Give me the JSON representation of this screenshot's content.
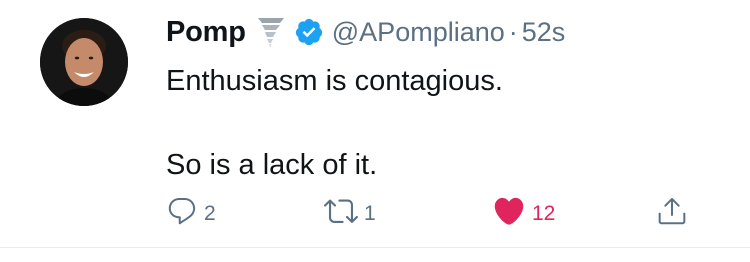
{
  "tweet": {
    "author_name": "Pomp",
    "handle": "@APompliano",
    "separator": "·",
    "time": "52s",
    "text_lines": [
      "Enthusiasm is contagious.",
      "",
      "So is a lack of it."
    ]
  },
  "actions": {
    "reply_count": "2",
    "retweet_count": "1",
    "like_count": "12"
  },
  "icons": {
    "author_emoji": "tornado-icon",
    "verified": "verified-badge-icon",
    "reply": "reply-icon",
    "retweet": "retweet-icon",
    "like": "heart-icon",
    "share": "share-icon"
  },
  "colors": {
    "verified_blue": "#1da1f2",
    "like_red": "#e0245e",
    "secondary_text": "#5b7083",
    "primary_text": "#0f1419"
  }
}
